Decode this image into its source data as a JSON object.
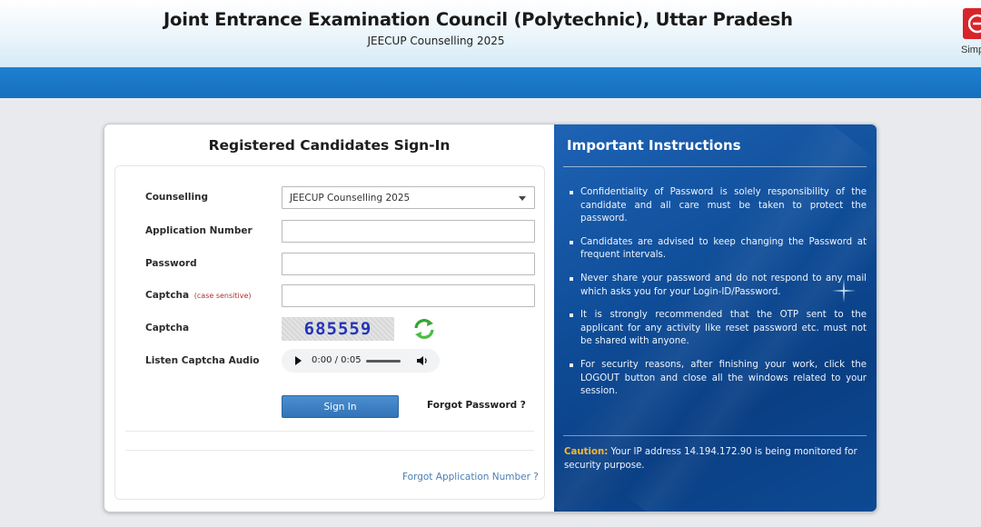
{
  "header": {
    "title": "Joint Entrance Examination Council (Polytechnic), Uttar Pradesh",
    "subtitle": "JEECUP Counselling 2025",
    "logo_text": "Simp",
    "logo_icon": "simplifi-logo-icon"
  },
  "form": {
    "title": "Registered Candidates Sign-In",
    "counselling_label": "Counselling",
    "counselling_value": "JEECUP Counselling 2025",
    "application_number_label": "Application Number",
    "application_number_value": "",
    "password_label": "Password",
    "password_value": "",
    "captcha_input_label": "Captcha",
    "captcha_input_note": "(case sensitive)",
    "captcha_input_value": "",
    "captcha_label": "Captcha",
    "captcha_text": "685559",
    "audio_label": "Listen Captcha Audio",
    "audio_time": "0:00 / 0:05",
    "signin_label": "Sign In",
    "forgot_password_label": "Forgot Password ?",
    "forgot_application_label": "Forgot Application Number ?"
  },
  "instructions": {
    "title": "Important Instructions",
    "items": [
      "Confidentiality of Password is solely responsibility of the candidate and all care must be taken to protect the password.",
      "Candidates are advised to keep changing the Password at frequent intervals.",
      "Never share your password and do not respond to any mail which asks you for your Login-ID/Password.",
      "It is strongly recommended that the OTP sent to the applicant for any activity like reset password etc. must not be shared with anyone.",
      "For security reasons, after finishing your work, click the LOGOUT button and close all the windows related to your session."
    ],
    "caution_key": "Caution:",
    "caution_text": " Your IP address 14.194.172.90 is being monitored for security purpose."
  },
  "colors": {
    "band": "#1570bd",
    "instructions_bg": "#0f4d98",
    "signin_button": "#3274b7",
    "caution_accent": "#f5b731",
    "captcha_note": "#b03030",
    "link": "#4a7fb5"
  }
}
